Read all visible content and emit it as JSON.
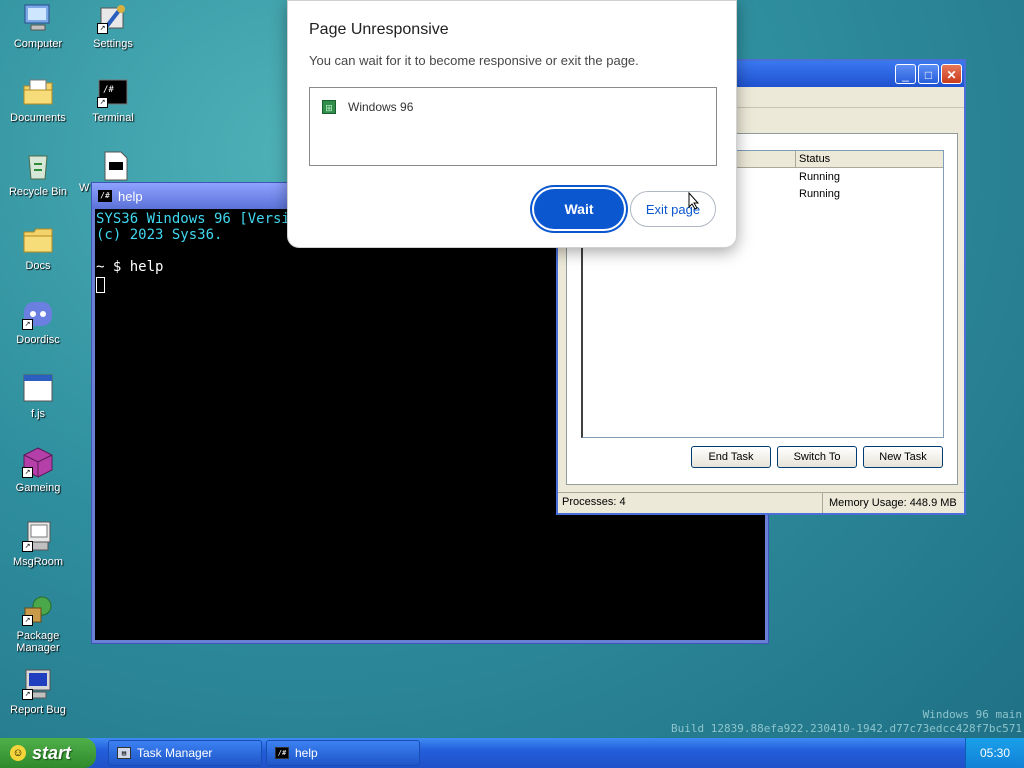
{
  "desktop": {
    "icons": [
      {
        "label": "Computer"
      },
      {
        "label": "Settings"
      },
      {
        "label": "Documents"
      },
      {
        "label": "Terminal"
      },
      {
        "label": "Recycle Bin"
      },
      {
        "label": "W"
      },
      {
        "label": "Docs"
      },
      {
        "label": "Doordisc"
      },
      {
        "label": "f.js"
      },
      {
        "label": "Gameing"
      },
      {
        "label": "MsgRoom"
      },
      {
        "label": "Package Manager"
      },
      {
        "label": "Report Bug"
      }
    ],
    "watermark": {
      "line1": "Windows 96 main",
      "line2": "Build 12839.88efa922.230410-1942.d77c73edcc428f7bc571"
    }
  },
  "terminal": {
    "title": "help",
    "icon_text": "/#",
    "lines": {
      "l1": "SYS36 Windows 96 [Versio",
      "l2": "(c) 2023 Sys36.",
      "l3": "~ $ help"
    }
  },
  "task_manager": {
    "column_status": "Status",
    "rows": [
      {
        "status": "Running"
      },
      {
        "status": "Running"
      }
    ],
    "buttons": {
      "end_task": "End Task",
      "switch_to": "Switch To",
      "new_task": "New Task"
    },
    "status_bar": {
      "processes": "Processes: 4",
      "memory": "Memory Usage: 448.9 MB"
    }
  },
  "dialog": {
    "title": "Page Unresponsive",
    "message": "You can wait for it to become responsive or exit the page.",
    "page_name": "Windows 96",
    "wait_label": "Wait",
    "exit_label": "Exit page"
  },
  "taskbar": {
    "start_label": "start",
    "tasks": [
      {
        "label": "Task Manager"
      },
      {
        "label": "help"
      }
    ],
    "clock": "05:30"
  }
}
